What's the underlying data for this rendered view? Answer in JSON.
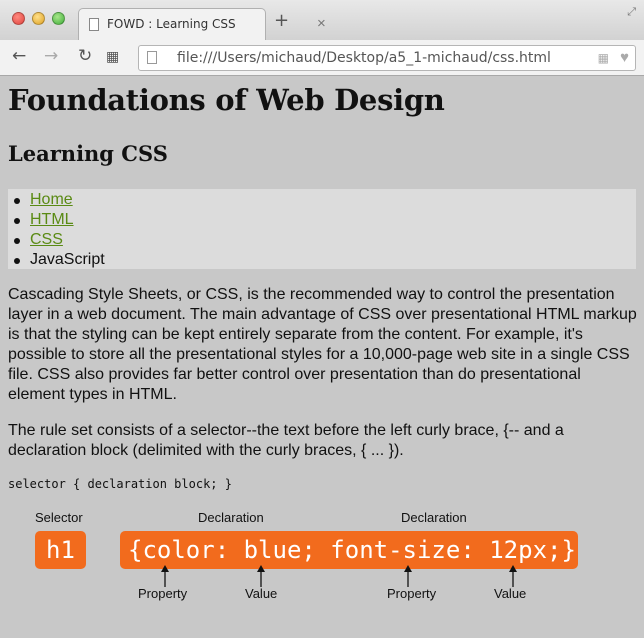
{
  "browser": {
    "tab_title": "FOWD : Learning CSS",
    "tab_close": "×",
    "new_tab": "+",
    "url": "file:///Users/michaud/Desktop/a5_1-michaud/css.html"
  },
  "page": {
    "title": "Foundations of Web Design",
    "subtitle": "Learning CSS",
    "nav": {
      "items": [
        {
          "label": "Home",
          "link": true
        },
        {
          "label": "HTML",
          "link": true
        },
        {
          "label": "CSS",
          "link": true
        },
        {
          "label": "JavaScript",
          "link": false
        }
      ],
      "link_color": "#5a8a14"
    },
    "paragraph1": "Cascading Style Sheets, or CSS, is the recommended way to control the presentation layer in a web document. The main advantage of CSS over presentational HTML markup is that the styling can be kept entirely separate from the content. For example, it's possible to store all the presentational styles for a 10,000-page web site in a single CSS file. CSS also provides far better control over presentation than do presentational element types in HTML.",
    "paragraph2": "The rule set consists of a selector--the text before the left curly brace, {-- and a declaration block (delimited with the curly braces, { ... }).",
    "code_sample": "selector { declaration block; }",
    "diagram": {
      "selector_label": "Selector",
      "declaration_label_1": "Declaration",
      "declaration_label_2": "Declaration",
      "selector_code": "h1",
      "declaration_code": "{color: blue; font-size: 12px;}",
      "property_label_1": "Property",
      "value_label_1": "Value",
      "property_label_2": "Property",
      "value_label_2": "Value",
      "accent_color": "#f26b1d"
    }
  }
}
